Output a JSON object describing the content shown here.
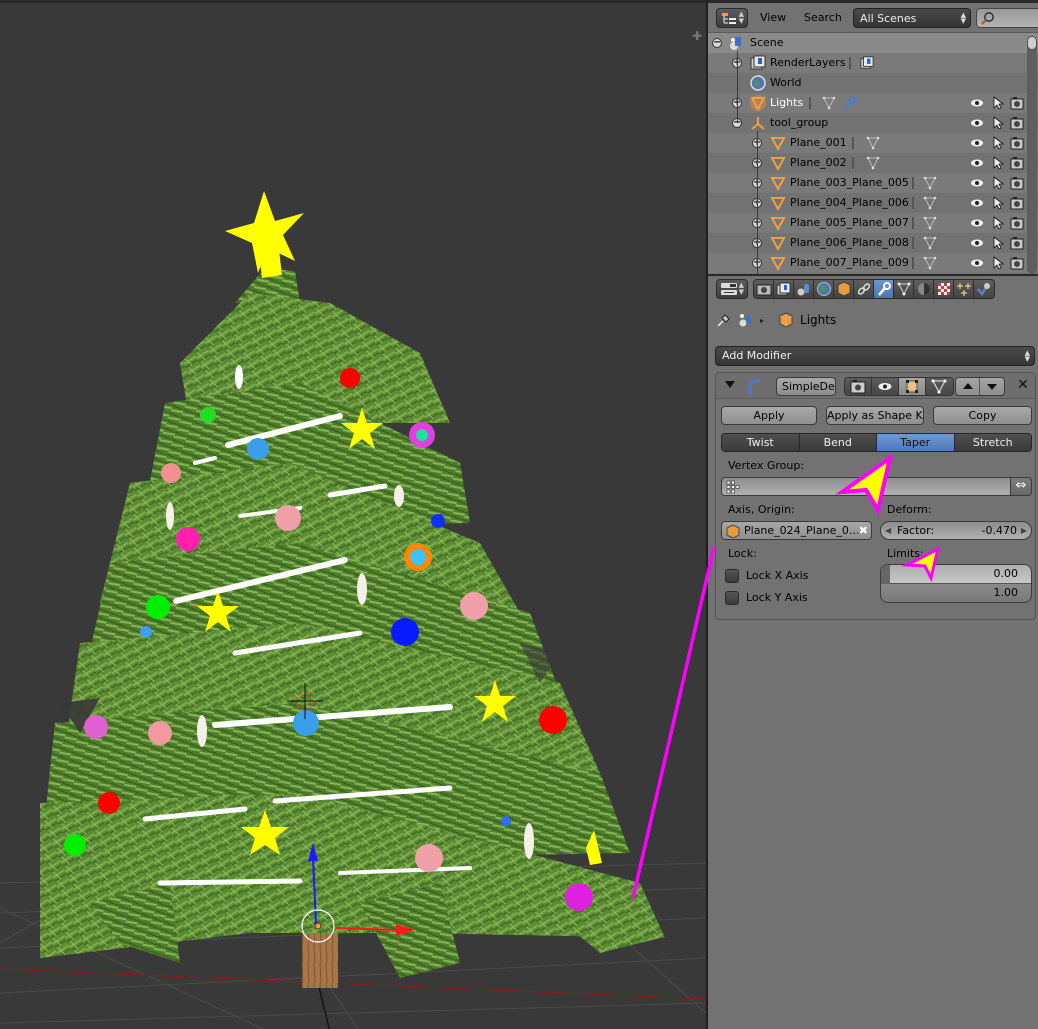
{
  "viewport": {
    "name": "3D View",
    "scene_description": "Textured Christmas tree with ornaments, stars and white garlands; object origin and transform manipulator at the trunk base"
  },
  "outliner": {
    "header": {
      "view_menu": "View",
      "search_menu": "Search",
      "scene_select": "All Scenes",
      "search_placeholder": ""
    },
    "rows": [
      {
        "label": "Scene",
        "icon": "scene-icon",
        "expander": "minus",
        "depth": 0
      },
      {
        "label": "RenderLayers",
        "icon": "render-layers-icon",
        "expander": "plus",
        "depth": 1,
        "extra_icons": [
          "render-layer-icon"
        ]
      },
      {
        "label": "World",
        "icon": "world-icon",
        "expander": "none",
        "depth": 1
      },
      {
        "label": "Lights",
        "icon": "mesh-object-icon",
        "expander": "plus",
        "depth": 1,
        "highlighted": true,
        "extra_icons": [
          "mesh-data-icon",
          "modifier-wrench-icon"
        ],
        "restrict": true
      },
      {
        "label": "tool_group",
        "icon": "empty-object-icon",
        "expander": "minus",
        "depth": 1,
        "restrict": true
      },
      {
        "label": "Plane_001",
        "icon": "mesh-object-icon",
        "expander": "plus",
        "depth": 2,
        "extra_icons": [
          "mesh-data-icon"
        ],
        "restrict": true
      },
      {
        "label": "Plane_002",
        "icon": "mesh-object-icon",
        "expander": "plus",
        "depth": 2,
        "extra_icons": [
          "mesh-data-icon"
        ],
        "restrict": true
      },
      {
        "label": "Plane_003_Plane_005",
        "icon": "mesh-object-icon",
        "expander": "plus",
        "depth": 2,
        "extra_icons": [
          "mesh-data-icon"
        ],
        "restrict": true
      },
      {
        "label": "Plane_004_Plane_006",
        "icon": "mesh-object-icon",
        "expander": "plus",
        "depth": 2,
        "extra_icons": [
          "mesh-data-icon"
        ],
        "restrict": true
      },
      {
        "label": "Plane_005_Plane_007",
        "icon": "mesh-object-icon",
        "expander": "plus",
        "depth": 2,
        "extra_icons": [
          "mesh-data-icon"
        ],
        "restrict": true
      },
      {
        "label": "Plane_006_Plane_008",
        "icon": "mesh-object-icon",
        "expander": "plus",
        "depth": 2,
        "extra_icons": [
          "mesh-data-icon"
        ],
        "restrict": true
      },
      {
        "label": "Plane_007_Plane_009",
        "icon": "mesh-object-icon",
        "expander": "plus",
        "depth": 2,
        "extra_icons": [
          "mesh-data-icon"
        ],
        "restrict": true
      }
    ],
    "restrict_columns": [
      "visibility-eye-icon",
      "selectability-cursor-icon",
      "renderability-camera-icon"
    ]
  },
  "properties": {
    "tabs": [
      {
        "name": "render",
        "icon": "camera-icon"
      },
      {
        "name": "render-layers",
        "icon": "render-layers-icon"
      },
      {
        "name": "scene",
        "icon": "scene-icon"
      },
      {
        "name": "world",
        "icon": "world-icon"
      },
      {
        "name": "object",
        "icon": "object-cube-icon"
      },
      {
        "name": "constraints",
        "icon": "constraint-link-icon"
      },
      {
        "name": "modifiers",
        "icon": "wrench-icon",
        "active": true
      },
      {
        "name": "data",
        "icon": "mesh-data-icon"
      },
      {
        "name": "material",
        "icon": "material-sphere-icon"
      },
      {
        "name": "texture",
        "icon": "texture-checker-icon"
      },
      {
        "name": "particles",
        "icon": "particles-icon"
      },
      {
        "name": "physics",
        "icon": "physics-icon"
      }
    ],
    "breadcrumb": {
      "object_name": "Lights"
    },
    "add_modifier_label": "Add Modifier",
    "modifier": {
      "name": "SimpleDe",
      "apply_label": "Apply",
      "apply_shape_label": "Apply as Shape K...",
      "copy_label": "Copy",
      "modes": [
        {
          "label": "Twist",
          "active": false
        },
        {
          "label": "Bend",
          "active": false
        },
        {
          "label": "Taper",
          "active": true
        },
        {
          "label": "Stretch",
          "active": false
        }
      ],
      "vertex_group_label": "Vertex Group:",
      "vertex_group_value": "",
      "axis_origin_label": "Axis, Origin:",
      "axis_origin_value": "Plane_024_Plane_0...",
      "deform_label": "Deform:",
      "factor_label": "Factor:",
      "factor_value": "-0.470",
      "lock_label": "Lock:",
      "lock_x_label": "Lock X Axis",
      "lock_x_checked": false,
      "lock_y_label": "Lock Y Axis",
      "lock_y_checked": false,
      "limits_label": "Limits:",
      "limit_min": "0.00",
      "limit_max": "1.00"
    }
  },
  "annotations": {
    "color_outline": "#ff00ff",
    "color_fill": "#ffff00",
    "items": [
      "arrow-pointing-to-taper",
      "arrow-pointing-to-limits",
      "line-to-branch-tip"
    ]
  },
  "colors": {
    "viewport_bg": "#393939",
    "panel_bg": "#727272",
    "active_tab": "#5680c2",
    "highlight_object": "#ffffff"
  }
}
